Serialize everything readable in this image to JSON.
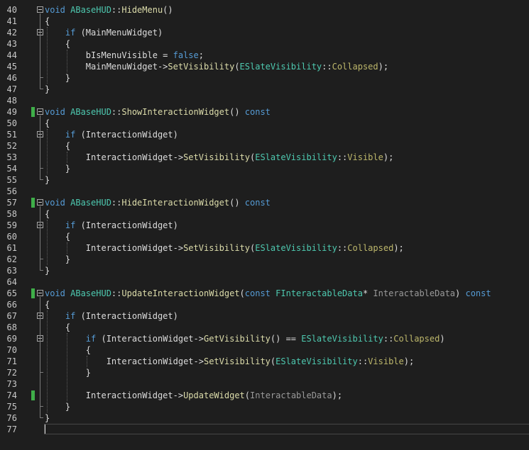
{
  "editor": {
    "colors": {
      "background": "#1e1e1e",
      "keyword": "#569cd6",
      "type": "#4ec9b0",
      "function": "#dcdcaa",
      "macro": "#bdb76b",
      "param": "#9a9a9a",
      "change_marker": "#3fae49"
    },
    "lines": [
      {
        "n": "40",
        "fold": true,
        "mod": false,
        "seg": [
          [
            "kw",
            "void "
          ],
          [
            "ty",
            "ABaseHUD"
          ],
          [
            "pl",
            "::"
          ],
          [
            "fn",
            "HideMenu"
          ],
          [
            "pl",
            "()"
          ]
        ]
      },
      {
        "n": "41",
        "fold": false,
        "mod": false,
        "seg": [
          [
            "pl",
            "{"
          ]
        ]
      },
      {
        "n": "42",
        "fold": true,
        "mod": false,
        "seg": [
          [
            "pl",
            "    "
          ],
          [
            "kw",
            "if"
          ],
          [
            "pl",
            " (MainMenuWidget)"
          ]
        ]
      },
      {
        "n": "43",
        "fold": false,
        "mod": false,
        "seg": [
          [
            "pl",
            "    {"
          ]
        ]
      },
      {
        "n": "44",
        "fold": false,
        "mod": false,
        "seg": [
          [
            "pl",
            "        bIsMenuVisible = "
          ],
          [
            "kw",
            "false"
          ],
          [
            "pl",
            ";"
          ]
        ]
      },
      {
        "n": "45",
        "fold": false,
        "mod": false,
        "seg": [
          [
            "pl",
            "        MainMenuWidget->"
          ],
          [
            "fn",
            "SetVisibility"
          ],
          [
            "pl",
            "("
          ],
          [
            "ty",
            "ESlateVisibility"
          ],
          [
            "pl",
            "::"
          ],
          [
            "mc",
            "Collapsed"
          ],
          [
            "pl",
            ");"
          ]
        ]
      },
      {
        "n": "46",
        "fold": false,
        "mod": false,
        "seg": [
          [
            "pl",
            "    }"
          ]
        ]
      },
      {
        "n": "47",
        "fold": false,
        "mod": false,
        "seg": [
          [
            "pl",
            "}"
          ]
        ]
      },
      {
        "n": "48",
        "fold": false,
        "mod": false,
        "seg": []
      },
      {
        "n": "49",
        "fold": true,
        "mod": true,
        "seg": [
          [
            "kw",
            "void "
          ],
          [
            "ty",
            "ABaseHUD"
          ],
          [
            "pl",
            "::"
          ],
          [
            "fn",
            "ShowInteractionWidget"
          ],
          [
            "pl",
            "() "
          ],
          [
            "kw",
            "const"
          ]
        ]
      },
      {
        "n": "50",
        "fold": false,
        "mod": false,
        "seg": [
          [
            "pl",
            "{"
          ]
        ]
      },
      {
        "n": "51",
        "fold": true,
        "mod": false,
        "seg": [
          [
            "pl",
            "    "
          ],
          [
            "kw",
            "if"
          ],
          [
            "pl",
            " (InteractionWidget)"
          ]
        ]
      },
      {
        "n": "52",
        "fold": false,
        "mod": false,
        "seg": [
          [
            "pl",
            "    {"
          ]
        ]
      },
      {
        "n": "53",
        "fold": false,
        "mod": false,
        "seg": [
          [
            "pl",
            "        InteractionWidget->"
          ],
          [
            "fn",
            "SetVisibility"
          ],
          [
            "pl",
            "("
          ],
          [
            "ty",
            "ESlateVisibility"
          ],
          [
            "pl",
            "::"
          ],
          [
            "mc",
            "Visible"
          ],
          [
            "pl",
            ");"
          ]
        ]
      },
      {
        "n": "54",
        "fold": false,
        "mod": false,
        "seg": [
          [
            "pl",
            "    }"
          ]
        ]
      },
      {
        "n": "55",
        "fold": false,
        "mod": false,
        "seg": [
          [
            "pl",
            "}"
          ]
        ]
      },
      {
        "n": "56",
        "fold": false,
        "mod": false,
        "seg": []
      },
      {
        "n": "57",
        "fold": true,
        "mod": true,
        "seg": [
          [
            "kw",
            "void "
          ],
          [
            "ty",
            "ABaseHUD"
          ],
          [
            "pl",
            "::"
          ],
          [
            "fn",
            "HideInteractionWidget"
          ],
          [
            "pl",
            "() "
          ],
          [
            "kw",
            "const"
          ]
        ]
      },
      {
        "n": "58",
        "fold": false,
        "mod": false,
        "seg": [
          [
            "pl",
            "{"
          ]
        ]
      },
      {
        "n": "59",
        "fold": true,
        "mod": false,
        "seg": [
          [
            "pl",
            "    "
          ],
          [
            "kw",
            "if"
          ],
          [
            "pl",
            " (InteractionWidget)"
          ]
        ]
      },
      {
        "n": "60",
        "fold": false,
        "mod": false,
        "seg": [
          [
            "pl",
            "    {"
          ]
        ]
      },
      {
        "n": "61",
        "fold": false,
        "mod": false,
        "seg": [
          [
            "pl",
            "        InteractionWidget->"
          ],
          [
            "fn",
            "SetVisibility"
          ],
          [
            "pl",
            "("
          ],
          [
            "ty",
            "ESlateVisibility"
          ],
          [
            "pl",
            "::"
          ],
          [
            "mc",
            "Collapsed"
          ],
          [
            "pl",
            ");"
          ]
        ]
      },
      {
        "n": "62",
        "fold": false,
        "mod": false,
        "seg": [
          [
            "pl",
            "    }"
          ]
        ]
      },
      {
        "n": "63",
        "fold": false,
        "mod": false,
        "seg": [
          [
            "pl",
            "}"
          ]
        ]
      },
      {
        "n": "64",
        "fold": false,
        "mod": false,
        "seg": []
      },
      {
        "n": "65",
        "fold": true,
        "mod": true,
        "seg": [
          [
            "kw",
            "void "
          ],
          [
            "ty",
            "ABaseHUD"
          ],
          [
            "pl",
            "::"
          ],
          [
            "fn",
            "UpdateInteractionWidget"
          ],
          [
            "pl",
            "("
          ],
          [
            "kw",
            "const "
          ],
          [
            "ty",
            "FInteractableData"
          ],
          [
            "pl",
            "* "
          ],
          [
            "pm",
            "InteractableData"
          ],
          [
            "pl",
            ") "
          ],
          [
            "kw",
            "const"
          ]
        ]
      },
      {
        "n": "66",
        "fold": false,
        "mod": false,
        "seg": [
          [
            "pl",
            "{"
          ]
        ]
      },
      {
        "n": "67",
        "fold": true,
        "mod": false,
        "seg": [
          [
            "pl",
            "    "
          ],
          [
            "kw",
            "if"
          ],
          [
            "pl",
            " (InteractionWidget)"
          ]
        ]
      },
      {
        "n": "68",
        "fold": false,
        "mod": false,
        "seg": [
          [
            "pl",
            "    {"
          ]
        ]
      },
      {
        "n": "69",
        "fold": true,
        "mod": false,
        "seg": [
          [
            "pl",
            "        "
          ],
          [
            "kw",
            "if"
          ],
          [
            "pl",
            " (InteractionWidget->"
          ],
          [
            "fn",
            "GetVisibility"
          ],
          [
            "pl",
            "() == "
          ],
          [
            "ty",
            "ESlateVisibility"
          ],
          [
            "pl",
            "::"
          ],
          [
            "mc",
            "Collapsed"
          ],
          [
            "pl",
            ")"
          ]
        ]
      },
      {
        "n": "70",
        "fold": false,
        "mod": false,
        "seg": [
          [
            "pl",
            "        {"
          ]
        ]
      },
      {
        "n": "71",
        "fold": false,
        "mod": false,
        "seg": [
          [
            "pl",
            "            InteractionWidget->"
          ],
          [
            "fn",
            "SetVisibility"
          ],
          [
            "pl",
            "("
          ],
          [
            "ty",
            "ESlateVisibility"
          ],
          [
            "pl",
            "::"
          ],
          [
            "mc",
            "Visible"
          ],
          [
            "pl",
            ");"
          ]
        ]
      },
      {
        "n": "72",
        "fold": false,
        "mod": false,
        "seg": [
          [
            "pl",
            "        }"
          ]
        ]
      },
      {
        "n": "73",
        "fold": false,
        "mod": false,
        "seg": []
      },
      {
        "n": "74",
        "fold": false,
        "mod": true,
        "seg": [
          [
            "pl",
            "        InteractionWidget->"
          ],
          [
            "fn",
            "UpdateWidget"
          ],
          [
            "pl",
            "("
          ],
          [
            "pm",
            "InteractableData"
          ],
          [
            "pl",
            ");"
          ]
        ]
      },
      {
        "n": "75",
        "fold": false,
        "mod": false,
        "seg": [
          [
            "pl",
            "    }"
          ]
        ]
      },
      {
        "n": "76",
        "fold": false,
        "mod": false,
        "seg": [
          [
            "pl",
            "}"
          ]
        ]
      },
      {
        "n": "77",
        "fold": false,
        "mod": false,
        "seg": []
      }
    ]
  }
}
